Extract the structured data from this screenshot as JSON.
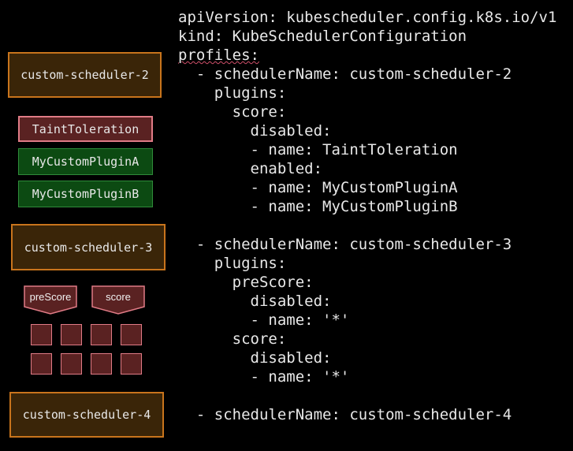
{
  "scheduler_boxes": {
    "s2": "custom-scheduler-2",
    "s3": "custom-scheduler-3",
    "s4": "custom-scheduler-4"
  },
  "plugins": {
    "taint": "TaintToleration",
    "plugin_a": "MyCustomPluginA",
    "plugin_b": "MyCustomPluginB"
  },
  "extension_points": {
    "prescore": "preScore",
    "score": "score"
  },
  "colors": {
    "scheduler_fill": "#3a2508",
    "scheduler_border": "#c8741c",
    "disabled_fill": "#5a2222",
    "disabled_border": "#e07b86",
    "enabled_fill": "#0c4a12",
    "enabled_border": "#2f8b3a"
  },
  "yaml": {
    "l01": "apiVersion: kubescheduler.config.k8s.io/v1",
    "l02": "kind: KubeSchedulerConfiguration",
    "l03": "profiles:",
    "l04": "  - schedulerName: custom-scheduler-2",
    "l05": "    plugins:",
    "l06": "      score:",
    "l07": "        disabled:",
    "l08": "        - name: TaintToleration",
    "l09": "        enabled:",
    "l10": "        - name: MyCustomPluginA",
    "l11": "        - name: MyCustomPluginB",
    "l12": "",
    "l13": "  - schedulerName: custom-scheduler-3",
    "l14": "    plugins:",
    "l15": "      preScore:",
    "l16": "        disabled:",
    "l17": "        - name: '*'",
    "l18": "      score:",
    "l19": "        disabled:",
    "l20": "        - name: '*'",
    "l21": "",
    "l22": "  - schedulerName: custom-scheduler-4"
  }
}
